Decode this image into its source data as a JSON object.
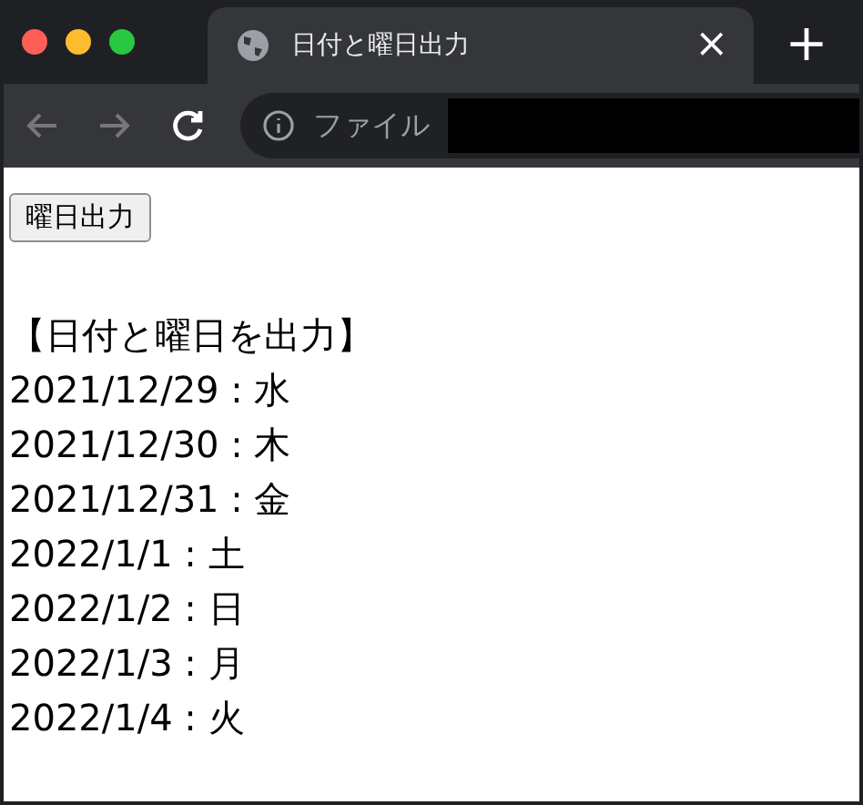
{
  "tab": {
    "title": "日付と曜日出力",
    "close": "×",
    "new_tab": "+"
  },
  "address_bar": {
    "label": "ファイル"
  },
  "content": {
    "button": "曜日出力",
    "heading": "【日付と曜日を出力】",
    "lines": [
      "2021/12/29 : 水",
      "2021/12/30 : 木",
      "2021/12/31 : 金",
      "2022/1/1 : 土",
      "2022/1/2 : 日",
      "2022/1/3 : 月",
      "2022/1/4 : 火"
    ]
  }
}
